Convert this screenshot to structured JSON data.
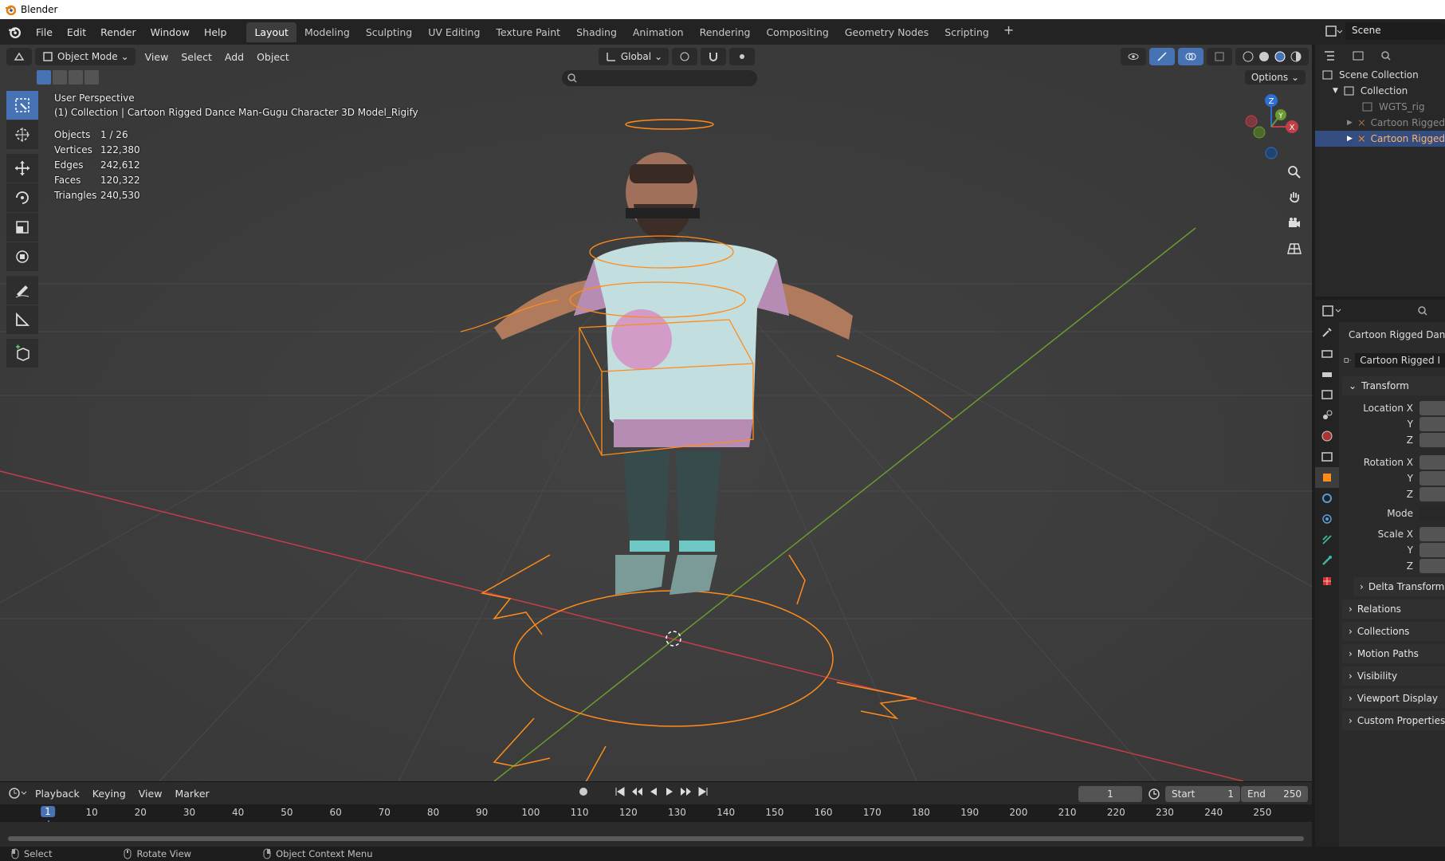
{
  "window": {
    "title": "Blender"
  },
  "topbar": {
    "menus": [
      "File",
      "Edit",
      "Render",
      "Window",
      "Help"
    ],
    "workspaces": [
      "Layout",
      "Modeling",
      "Sculpting",
      "UV Editing",
      "Texture Paint",
      "Shading",
      "Animation",
      "Rendering",
      "Compositing",
      "Geometry Nodes",
      "Scripting"
    ],
    "add_tab": "+",
    "scene": "Scene"
  },
  "viewport": {
    "mode": "Object Mode",
    "menus": [
      "View",
      "Select",
      "Add",
      "Object"
    ],
    "orientation": "Global",
    "options_label": "Options",
    "perspective": "User Perspective",
    "context": "(1) Collection | Cartoon Rigged Dance Man-Gugu Character 3D Model_Rigify",
    "stats": [
      {
        "label": "Objects",
        "value": "1 / 26"
      },
      {
        "label": "Vertices",
        "value": "122,380"
      },
      {
        "label": "Edges",
        "value": "242,612"
      },
      {
        "label": "Faces",
        "value": "120,322"
      },
      {
        "label": "Triangles",
        "value": "240,530"
      }
    ],
    "gizmo_axes": {
      "x": "X",
      "y": "Y",
      "z": "Z"
    },
    "colors": {
      "x_axis": "#c43e48",
      "y_axis": "#6a9a30",
      "selection": "#ff8c1a",
      "active_blue": "#4772b3"
    }
  },
  "timeline": {
    "menus": [
      "Playback",
      "Keying",
      "View",
      "Marker"
    ],
    "current_frame": "1",
    "start_label": "Start",
    "start": "1",
    "end_label": "End",
    "end": "250",
    "ruler": [
      "10",
      "20",
      "30",
      "40",
      "50",
      "60",
      "70",
      "80",
      "90",
      "100",
      "110",
      "120",
      "130",
      "140",
      "150",
      "160",
      "170",
      "180",
      "190",
      "200",
      "210",
      "220",
      "230",
      "240",
      "250"
    ]
  },
  "statusbar": {
    "items": [
      "Select",
      "Rotate View",
      "Object Context Menu"
    ]
  },
  "outliner": {
    "items": [
      {
        "label": "Scene Collection",
        "state": "normal"
      },
      {
        "label": "Collection",
        "state": "normal"
      },
      {
        "label": "WGTS_rig",
        "state": "dim"
      },
      {
        "label": "Cartoon Rigged",
        "state": "dim"
      },
      {
        "label": "Cartoon Rigged",
        "state": "selected"
      }
    ]
  },
  "properties": {
    "object_name": "Cartoon Rigged Dan",
    "data_name": "Cartoon Rigged I",
    "transform_label": "Transform",
    "fields": [
      "Location X",
      "Y",
      "Z",
      "Rotation X",
      "Y",
      "Z",
      "Mode",
      "Scale X",
      "Y",
      "Z"
    ],
    "delta_label": "Delta Transform",
    "panels": [
      "Relations",
      "Collections",
      "Motion Paths",
      "Visibility",
      "Viewport Display",
      "Custom Properties"
    ]
  }
}
